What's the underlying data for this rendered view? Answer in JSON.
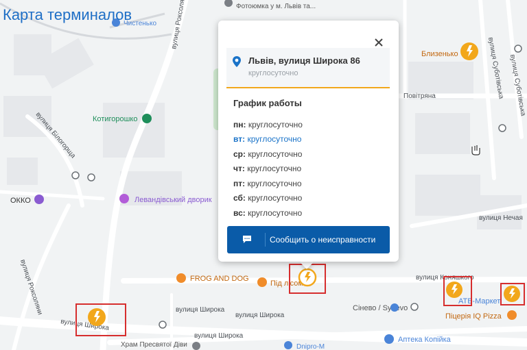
{
  "page_title": "Карта терминалов",
  "map": {
    "streets": [
      "вулиця Роксоляни",
      "вулиця Білогорща",
      "вулиця Роксоляни",
      "вулиця Широка",
      "вулиця Широка",
      "вулиця Широка",
      "вулиця Широка",
      "вулиця Коняшкого",
      "вулиця Нечая",
      "Повітряна",
      "вулиця Суботівська",
      "вулиця Суботівська"
    ],
    "pois": [
      "Фотоюмка у м. Львів та...",
      "Чистенько",
      "Котигорошко",
      "ОККО",
      "Левандівський дворик",
      "FROG AND DOG",
      "Під лісом",
      "Сінево / Synevo",
      "АТБ-Маркет",
      "Піцерія IQ Pizza",
      "Аптека Копійка",
      "Храм Пресвятої Діви",
      "Dnipro-M",
      "Близенько"
    ]
  },
  "popup": {
    "address": "Львів, вулиця Широка 86",
    "hours": "круглосуточно",
    "schedule_title": "График работы",
    "schedule": [
      {
        "day": "пн:",
        "hours": "круглосуточно"
      },
      {
        "day": "вт:",
        "hours": "круглосуточно"
      },
      {
        "day": "ср:",
        "hours": "круглосуточно"
      },
      {
        "day": "чт:",
        "hours": "круглосуточно"
      },
      {
        "day": "пт:",
        "hours": "круглосуточно"
      },
      {
        "day": "сб:",
        "hours": "круглосуточно"
      },
      {
        "day": "вс:",
        "hours": "круглосуточно"
      }
    ],
    "report_button": "Сообщить о неисправности"
  },
  "colors": {
    "accent": "#f2a71b",
    "button": "#0a5ba8",
    "highlight": "#d62d2d",
    "title": "#1f6fc6",
    "park": "#cfe9cf"
  },
  "icons": {
    "close": "close-icon",
    "pin": "location-pin-icon",
    "chat": "chat-bubble-icon",
    "terminal": "terminal-marker-icon"
  }
}
